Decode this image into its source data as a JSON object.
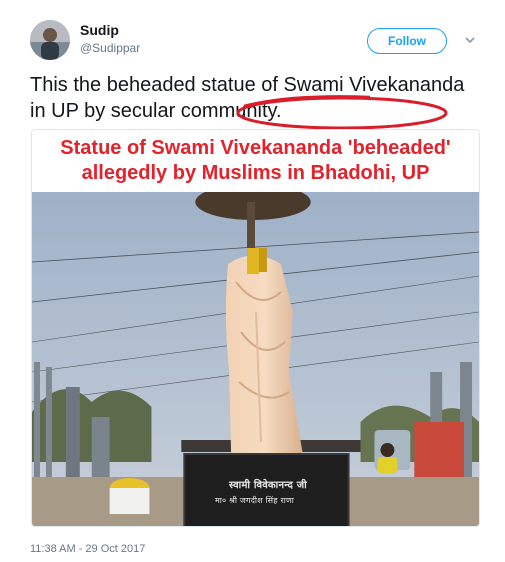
{
  "author": {
    "name": "Sudip",
    "handle": "@Sudippar"
  },
  "follow_label": "Follow",
  "tweet": {
    "text_before": "This the beheaded statue of Swami Vivekananda in UP by ",
    "text_circled": "secular community."
  },
  "media": {
    "headline_line1": "Statue of Swami Vivekananda 'beheaded'",
    "headline_line2": "allegedly by Muslims in Bhadohi, UP",
    "plaque_title": "स्वामी विवेकानन्द जी",
    "plaque_name": "मा० श्री जगदीश सिंह राणा"
  },
  "timestamp": "11:38 AM - 29 Oct 2017",
  "colors": {
    "accent": "#1da1f2",
    "headline_red": "#e3222b",
    "circle_red": "#d81e2a"
  },
  "icons": {
    "chevron": "chevron-down-icon"
  }
}
